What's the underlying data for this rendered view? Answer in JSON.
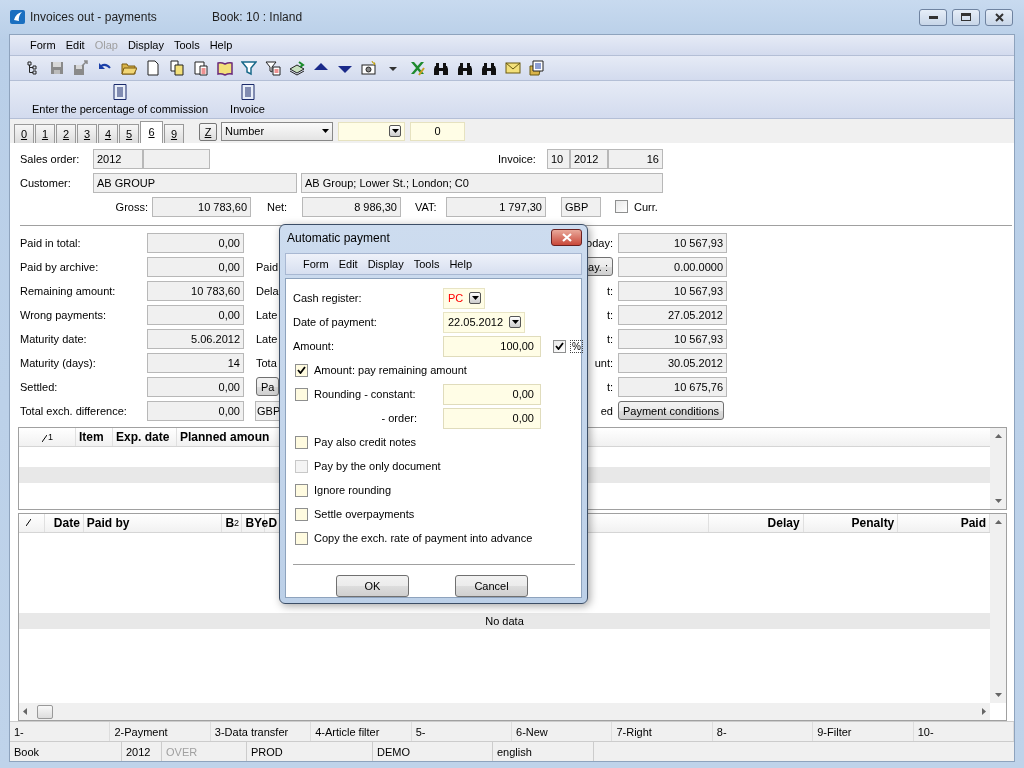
{
  "window": {
    "title": "Invoices out - payments",
    "book": "Book: 10 : Inland"
  },
  "menu": [
    {
      "label": "Form",
      "disabled": false
    },
    {
      "label": "Edit",
      "disabled": false
    },
    {
      "label": "Olap",
      "disabled": true
    },
    {
      "label": "Display",
      "disabled": false
    },
    {
      "label": "Tools",
      "disabled": false
    },
    {
      "label": "Help",
      "disabled": false
    }
  ],
  "command_bar": [
    "Enter the percentage of commission",
    "Invoice"
  ],
  "tabs": [
    {
      "label": "0",
      "selected": false
    },
    {
      "label": "1",
      "selected": false
    },
    {
      "label": "2",
      "selected": false
    },
    {
      "label": "3",
      "selected": false
    },
    {
      "label": "4",
      "selected": false
    },
    {
      "label": "5",
      "selected": false
    },
    {
      "label": "6",
      "selected": true
    },
    {
      "label": "9",
      "selected": false
    }
  ],
  "filter": {
    "button": "Z",
    "sort_by": "Number",
    "count": "0"
  },
  "header_form": {
    "sales_order": {
      "label": "Sales order:",
      "value": "2012"
    },
    "invoice": {
      "label": "Invoice:",
      "values": [
        "10",
        "2012",
        "16"
      ]
    },
    "customer": {
      "label": "Customer:",
      "value": "AB GROUP",
      "address": "AB Group; Lower St.; London; C0"
    },
    "totals": [
      {
        "label": "Gross:",
        "value": "10 783,60"
      },
      {
        "label": "Net:",
        "value": "8 986,30"
      },
      {
        "label": "VAT:",
        "value": "1 797,30"
      }
    ],
    "currency": "GBP",
    "curr": {
      "label": "Curr.",
      "checked": false
    }
  },
  "payment_rows": [
    {
      "label": "Paid in total:",
      "value": "0,00",
      "right_label": {
        "kind": "text",
        "text": "oday:"
      },
      "right_value": {
        "kind": "field",
        "text": "10 567,93"
      }
    },
    {
      "label": "Paid by archive:",
      "value": "0,00",
      "middle": {
        "kind": "text",
        "text": "Paid"
      },
      "right_label": {
        "kind": "button",
        "text": "ay. :"
      },
      "right_value": {
        "kind": "field",
        "text": "0.00.0000"
      }
    },
    {
      "label": "Remaining amount:",
      "value": "10 783,60",
      "middle": {
        "kind": "text",
        "text": "Dela"
      },
      "right_label": {
        "kind": "text",
        "text": "t:"
      },
      "right_value": {
        "kind": "field",
        "text": "10 567,93"
      }
    },
    {
      "label": "Wrong payments:",
      "value": "0,00",
      "middle": {
        "kind": "text",
        "text": "Late"
      },
      "right_label": {
        "kind": "text",
        "text": "t:"
      },
      "right_value": {
        "kind": "field",
        "text": "27.05.2012"
      }
    },
    {
      "label": "Maturity date:",
      "value": "5.06.2012",
      "middle": {
        "kind": "text",
        "text": "Late"
      },
      "right_label": {
        "kind": "text",
        "text": "t:"
      },
      "right_value": {
        "kind": "field",
        "text": "10 567,93"
      }
    },
    {
      "label": "Maturity (days):",
      "value": "14",
      "middle": {
        "kind": "text",
        "text": "Tota"
      },
      "right_label": {
        "kind": "text",
        "text": "unt:"
      },
      "right_value": {
        "kind": "field",
        "text": "30.05.2012"
      }
    },
    {
      "label": "Settled:",
      "value": "0,00",
      "middle": {
        "kind": "button",
        "text": "Pa"
      },
      "right_label": {
        "kind": "text",
        "text": "t:"
      },
      "right_value": {
        "kind": "field",
        "text": "10 675,76"
      }
    },
    {
      "label": "Total exch. difference:",
      "value": "0,00",
      "middle": {
        "kind": "field",
        "text": "GBP"
      },
      "right_label": {
        "kind": "text",
        "text": "ed"
      },
      "right_value": {
        "kind": "button",
        "text": "Payment conditions"
      }
    }
  ],
  "plan_table": {
    "columns": [
      {
        "label": "1",
        "kind": "sort"
      },
      {
        "label": "Item",
        "kind": "text"
      },
      {
        "label": "Exp. date",
        "kind": "text"
      },
      {
        "label": "Planned amoun",
        "kind": "text"
      }
    ]
  },
  "payments_table": {
    "columns": [
      {
        "kind": "sort"
      },
      {
        "label": "Date",
        "kind": "text"
      },
      {
        "label": "Paid by",
        "kind": "text"
      },
      {
        "label": "B",
        "kind": "sort_text",
        "sort_index": "2"
      },
      {
        "label": "BYe",
        "kind": "text"
      },
      {
        "label": "D",
        "kind": "text"
      },
      {
        "label": "Delay",
        "kind": "text"
      },
      {
        "label": "Penalty",
        "kind": "text"
      },
      {
        "label": "Paid",
        "kind": "text"
      }
    ],
    "empty_text": "No data"
  },
  "function_keys": [
    "1-",
    "2-Payment",
    "3-Data transfer",
    "4-Article filter",
    "5-",
    "6-New",
    "7-Right",
    "8-",
    "9-Filter",
    "10-"
  ],
  "status_bar": [
    {
      "text": "Book",
      "disabled": false
    },
    {
      "text": "2012",
      "disabled": false
    },
    {
      "text": "OVER",
      "disabled": true
    },
    {
      "text": "PROD",
      "disabled": false
    },
    {
      "text": "DEMO",
      "disabled": false
    },
    {
      "text": "english",
      "disabled": false
    }
  ],
  "dialog": {
    "title": "Automatic payment",
    "menu": [
      "Form",
      "Edit",
      "Display",
      "Tools",
      "Help"
    ],
    "fields": [
      {
        "label": "Cash register:",
        "value": "PC",
        "kind": "combo",
        "required": true
      },
      {
        "label": "Date of payment:",
        "value": "22.05.2012",
        "kind": "combo",
        "required": false
      },
      {
        "label": "Amount:",
        "value": "100,00",
        "kind": "amount",
        "required": false,
        "checked": true,
        "toggle": "%"
      }
    ],
    "options": [
      {
        "kind": "check",
        "label": "Amount: pay remaining amount",
        "checked": true,
        "disabled": false
      },
      {
        "kind": "check_field",
        "label": "Rounding - constant:",
        "value": "0,00",
        "checked": false,
        "disabled": false
      },
      {
        "kind": "field",
        "label": "- order:",
        "value": "0,00"
      },
      {
        "kind": "check",
        "label": "Pay also credit notes",
        "checked": false,
        "disabled": false
      },
      {
        "kind": "check",
        "label": "Pay by the only document",
        "checked": false,
        "disabled": true
      },
      {
        "kind": "check",
        "label": "Ignore rounding",
        "checked": false,
        "disabled": false
      },
      {
        "kind": "check",
        "label": "Settle overpayments",
        "checked": false,
        "disabled": false
      },
      {
        "kind": "check",
        "label": "Copy the exch. rate of payment into advance",
        "checked": false,
        "disabled": false
      }
    ],
    "buttons": [
      "OK",
      "Cancel"
    ]
  }
}
